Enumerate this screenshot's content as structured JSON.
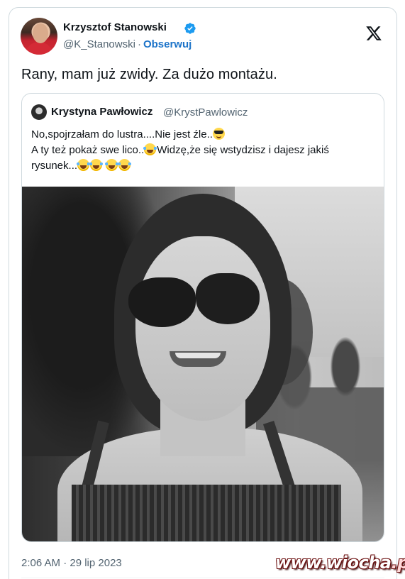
{
  "tweet": {
    "author_name": "Krzysztof Stanowski",
    "author_handle": "@K_Stanowski",
    "separator": "·",
    "follow_label": "Obserwuj",
    "text": "Rany, mam już zwidy. Za dużo montażu.",
    "timestamp": "2:06 AM · 29 lip 2023",
    "logo_icon": "x-logo-icon",
    "verified_icon": "verified-badge-icon"
  },
  "quote": {
    "author_name": "Krystyna Pawłowicz",
    "author_handle": "@KrystPawlowicz",
    "line1": "No,spojrzałam do lustra....Nie jest źle..",
    "line2a": "A ty też pokaż swe lico..",
    "line2b": "Widzę,że się wstydzisz i dajesz jakiś",
    "line3": "rysunek...",
    "emojis": [
      "smiling-face-with-sunglasses",
      "face-with-tears-of-joy"
    ],
    "image_alt": "black-and-white photo of a smiling woman in sunglasses"
  },
  "watermark": {
    "text_main": "www.wiocha",
    "text_tld": ".pl"
  },
  "colors": {
    "accent_blue": "#1d74c9",
    "verified_blue": "#1d9bf0",
    "secondary_text": "#536471",
    "border": "#cfd9de"
  }
}
